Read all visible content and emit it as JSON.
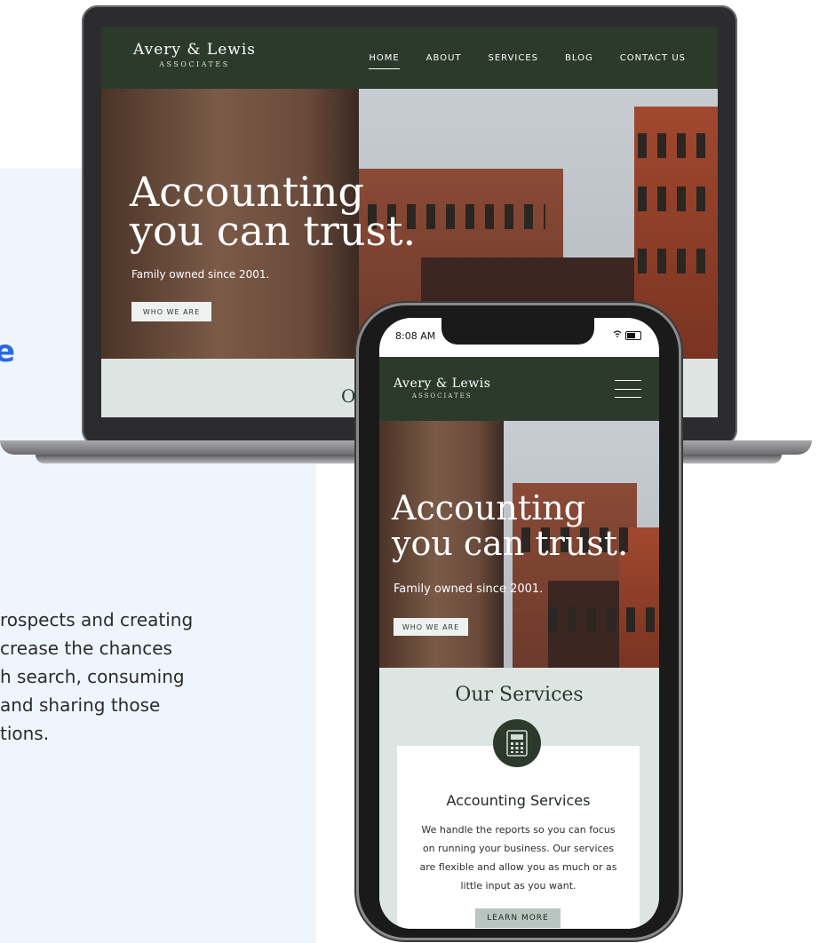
{
  "left_panel": {
    "accent_fragment": "e",
    "body_lines": [
      "rospects and creating",
      "crease the chances",
      "h search, consuming",
      " and sharing those",
      "tions."
    ]
  },
  "site": {
    "brand_name": "Avery & Lewis",
    "brand_sub": "ASSOCIATES",
    "nav": [
      "HOME",
      "ABOUT",
      "SERVICES",
      "BLOG",
      "CONTACT US"
    ],
    "hero_title_line1": "Accounting",
    "hero_title_line2": "you can trust.",
    "hero_sub": "Family owned since 2001.",
    "hero_button": "WHO WE ARE",
    "services_peek": "O",
    "services_title": "Our Services",
    "card_title": "Accounting Services",
    "card_text": "We handle the reports so you can focus on running your business. Our services are flexible and allow you as much or as little input as you want.",
    "card_button": "LEARN MORE"
  },
  "phone": {
    "status_time": "8:08 AM",
    "icon_color": "#2c3a2c"
  },
  "colors": {
    "brand_dark": "#2c3a2c",
    "accent_blue": "#2a6ae6",
    "panel_bg": "#eff5fd",
    "services_bg": "#dde5e3"
  }
}
